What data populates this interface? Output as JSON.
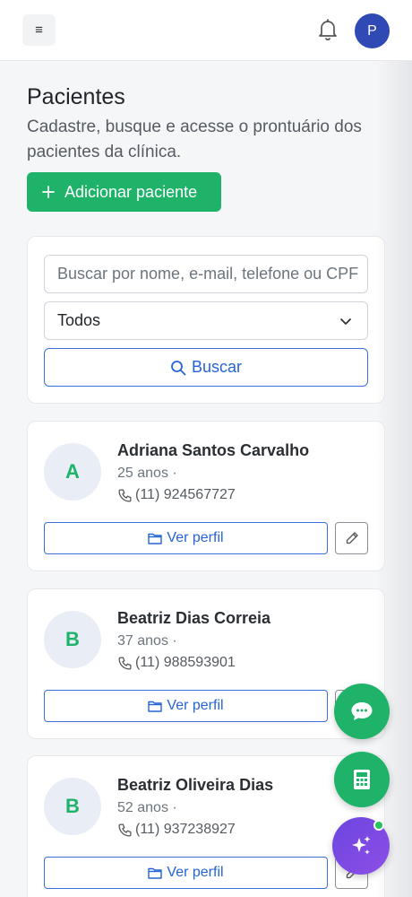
{
  "topbar": {
    "menu_icon": "≡",
    "avatar_initial": "P"
  },
  "page": {
    "title": "Pacientes",
    "subtitle": "Cadastre, busque e acesse o prontuário dos pacientes da clínica.",
    "add_button": "Adicionar paciente"
  },
  "search": {
    "placeholder": "Buscar por nome, e-mail, telefone ou CPF",
    "filter_value": "Todos",
    "button": "Buscar"
  },
  "patients": [
    {
      "initial": "A",
      "name": "Adriana Santos Carvalho",
      "age": "25 anos ·",
      "phone": "(11) 924567727",
      "view_label": "Ver perfil"
    },
    {
      "initial": "B",
      "name": "Beatriz Dias Correia",
      "age": "37 anos ·",
      "phone": "(11) 988593901",
      "view_label": "Ver perfil"
    },
    {
      "initial": "B",
      "name": "Beatriz Oliveira Dias",
      "age": "52 anos ·",
      "phone": "(11) 937238927",
      "view_label": "Ver perfil"
    }
  ],
  "colors": {
    "primary_green": "#1fb36a",
    "link_blue": "#2563d6",
    "avatar_blue": "#2f49b5",
    "ai_purple": "#7a4ae3"
  },
  "icons": [
    "menu-icon",
    "bell-icon",
    "plus-icon",
    "search-icon",
    "chevron-down-icon",
    "phone-icon",
    "folder-icon",
    "pencil-icon",
    "chat-icon",
    "calculator-icon",
    "sparkles-icon"
  ]
}
